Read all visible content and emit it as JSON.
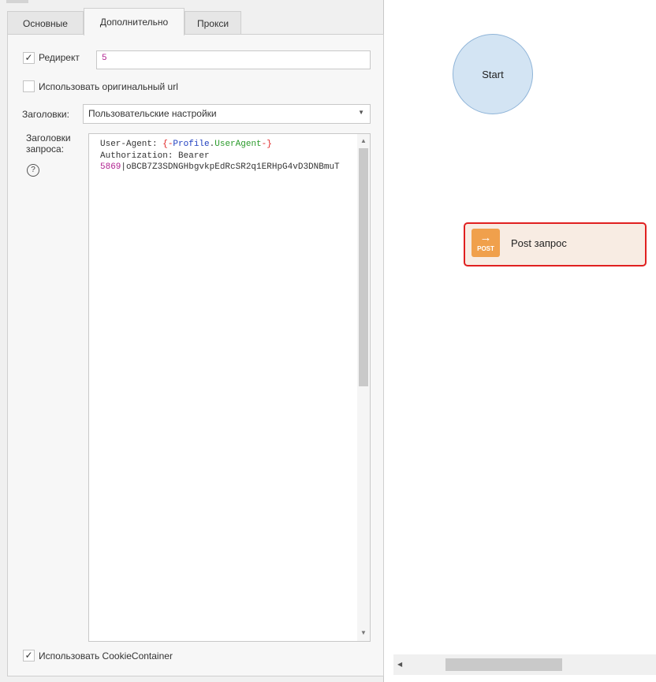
{
  "tabs": [
    {
      "label": "Основные",
      "active": false
    },
    {
      "label": "Дополнительно",
      "active": true
    },
    {
      "label": "Прокси",
      "active": false
    }
  ],
  "settings": {
    "redirect": {
      "label": "Редирект",
      "checked": true,
      "value": "5"
    },
    "original_url": {
      "label": "Использовать оригинальный url",
      "checked": false
    },
    "headers_select": {
      "label": "Заголовки:",
      "value": "Пользовательские настройки"
    },
    "request_headers": {
      "label_line1": "Заголовки",
      "label_line2": "запроса:",
      "help_glyph": "?",
      "lines": [
        {
          "parts": [
            {
              "text": "User-Agent: ",
              "color": "#333333"
            },
            {
              "text": "{-",
              "color": "#e02020"
            },
            {
              "text": "Profile",
              "color": "#2040c0"
            },
            {
              "text": ".",
              "color": "#333333"
            },
            {
              "text": "UserAgent",
              "color": "#2a9a2a"
            },
            {
              "text": "-}",
              "color": "#e02020"
            }
          ]
        },
        {
          "parts": [
            {
              "text": "Authorization: Bearer",
              "color": "#333333"
            }
          ]
        },
        {
          "parts": [
            {
              "text": "5869",
              "color": "#b0208f"
            },
            {
              "text": "|oBCB7Z3SDNGHbgvkpEdRcSR2q1ERHpG4vD3DNBmuT",
              "color": "#333333"
            }
          ]
        }
      ]
    },
    "cookie_container": {
      "label": "Использовать CookieContainer",
      "checked": true
    }
  },
  "canvas": {
    "start_node": {
      "label": "Start"
    },
    "post_node": {
      "label": "Post запрос",
      "icon_text": "POST",
      "icon_arrow": "→"
    }
  },
  "icons": {
    "checkmark": "✓",
    "dropdown": "▼",
    "scroll_up": "▲",
    "scroll_down": "▼",
    "scroll_left": "◀"
  },
  "colors": {
    "start_fill": "#d3e4f3",
    "post_fill": "#f8ece3",
    "post_border": "#e02020",
    "post_icon": "#f0a04c"
  }
}
